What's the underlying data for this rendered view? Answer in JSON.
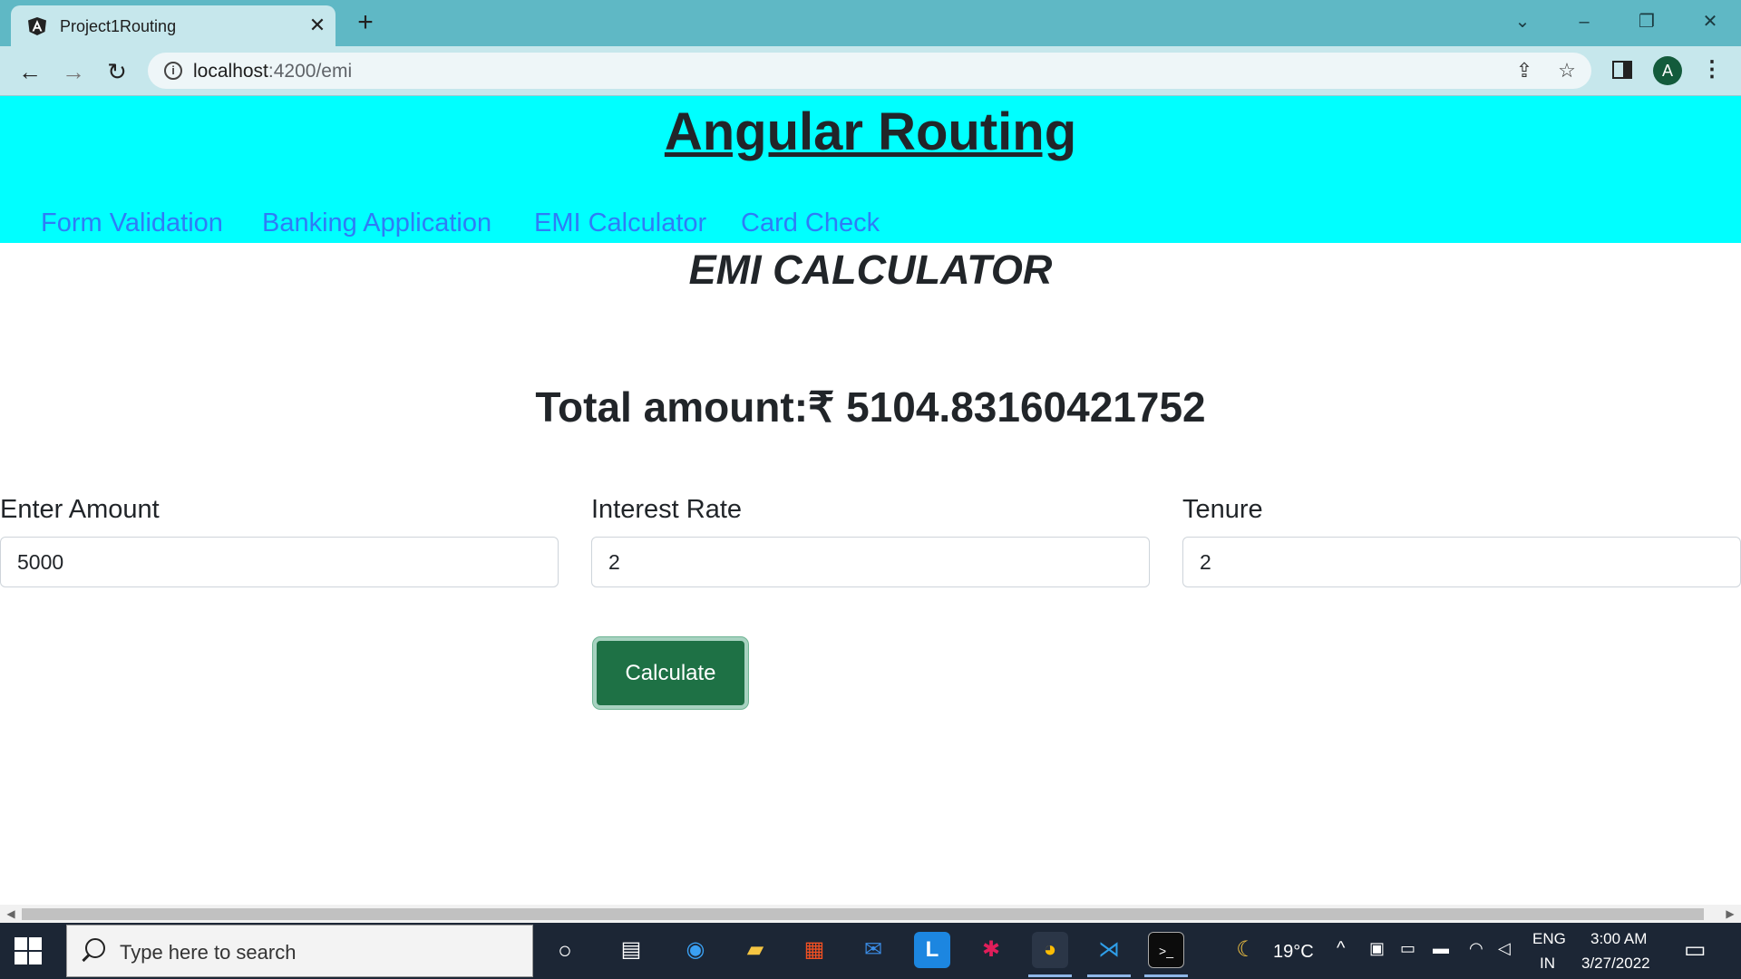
{
  "browser": {
    "tab_title": "Project1Routing",
    "url_host": "localhost",
    "url_rest": ":4200/emi"
  },
  "header": {
    "site_title": "Angular Routing",
    "nav": [
      "Form Validation",
      "Banking Application",
      "EMI Calculator",
      "Card Check"
    ]
  },
  "main": {
    "page_title": "EMI CALCULATOR",
    "total_label": "Total amount:",
    "total_currency": "₹",
    "total_value": "5104.83160421752",
    "fields": [
      {
        "label": "Enter Amount",
        "value": "5000"
      },
      {
        "label": "Interest Rate",
        "value": "2"
      },
      {
        "label": "Tenure",
        "value": "2"
      }
    ],
    "calculate_label": "Calculate"
  },
  "colors": {
    "header_bg": "#00ffff",
    "nav_link": "#2f7cf6",
    "button_bg": "#1e7145",
    "chrome_tabbar": "#5fb8c5"
  },
  "taskbar": {
    "search_placeholder": "Type here to search",
    "weather": "19°C",
    "lang_top": "ENG",
    "lang_bottom": "IN",
    "time": "3:00 AM",
    "date": "3/27/2022"
  },
  "profile": {
    "initial": "A"
  }
}
